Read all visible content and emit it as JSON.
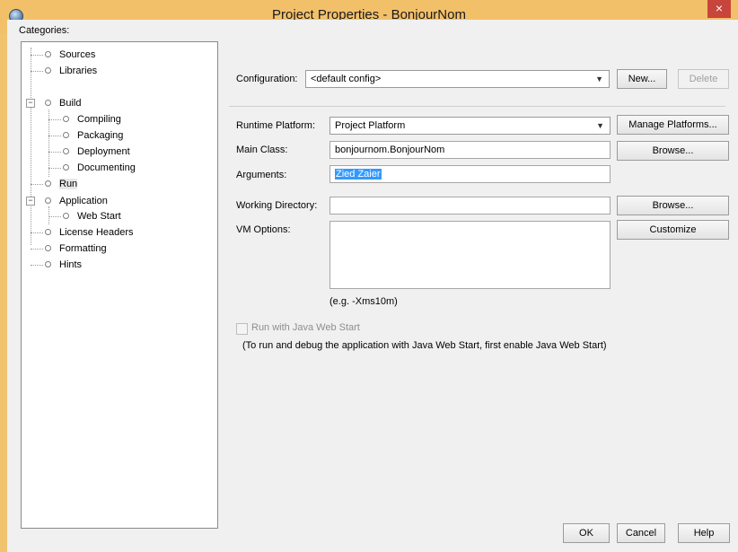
{
  "window": {
    "title": "Project Properties - BonjourNom",
    "close_symbol": "×",
    "app_icon": "app-icon"
  },
  "categories": {
    "label": "Categories:",
    "tree": [
      {
        "label": "Sources"
      },
      {
        "label": "Libraries"
      },
      {
        "label": "Build",
        "expander": "−"
      },
      {
        "label": "Compiling"
      },
      {
        "label": "Packaging"
      },
      {
        "label": "Deployment"
      },
      {
        "label": "Documenting"
      },
      {
        "label": "Run",
        "selected": true
      },
      {
        "label": "Application",
        "expander": "−"
      },
      {
        "label": "Web Start"
      },
      {
        "label": "License Headers"
      },
      {
        "label": "Formatting"
      },
      {
        "label": "Hints"
      }
    ]
  },
  "config": {
    "label": "Configuration:",
    "value": "<default config>",
    "new_label": "New...",
    "delete_label": "Delete"
  },
  "runtime": {
    "label": "Runtime Platform:",
    "value": "Project Platform",
    "manage_label": "Manage Platforms..."
  },
  "main_class": {
    "label": "Main Class:",
    "value": "bonjournom.BonjourNom",
    "browse_label": "Browse..."
  },
  "arguments": {
    "label": "Arguments:",
    "value": "Zied Zaier"
  },
  "working_dir": {
    "label": "Working Directory:",
    "value": "",
    "browse_label": "Browse..."
  },
  "vm_options": {
    "label": "VM Options:",
    "value": "",
    "customize_label": "Customize",
    "hint": "(e.g. -Xms10m)"
  },
  "web_start": {
    "checkbox_label": "Run with Java Web Start",
    "note": "(To run and debug the application with Java Web Start, first enable Java Web Start)"
  },
  "footer": {
    "ok_label": "OK",
    "cancel_label": "Cancel",
    "help_label": "Help"
  }
}
